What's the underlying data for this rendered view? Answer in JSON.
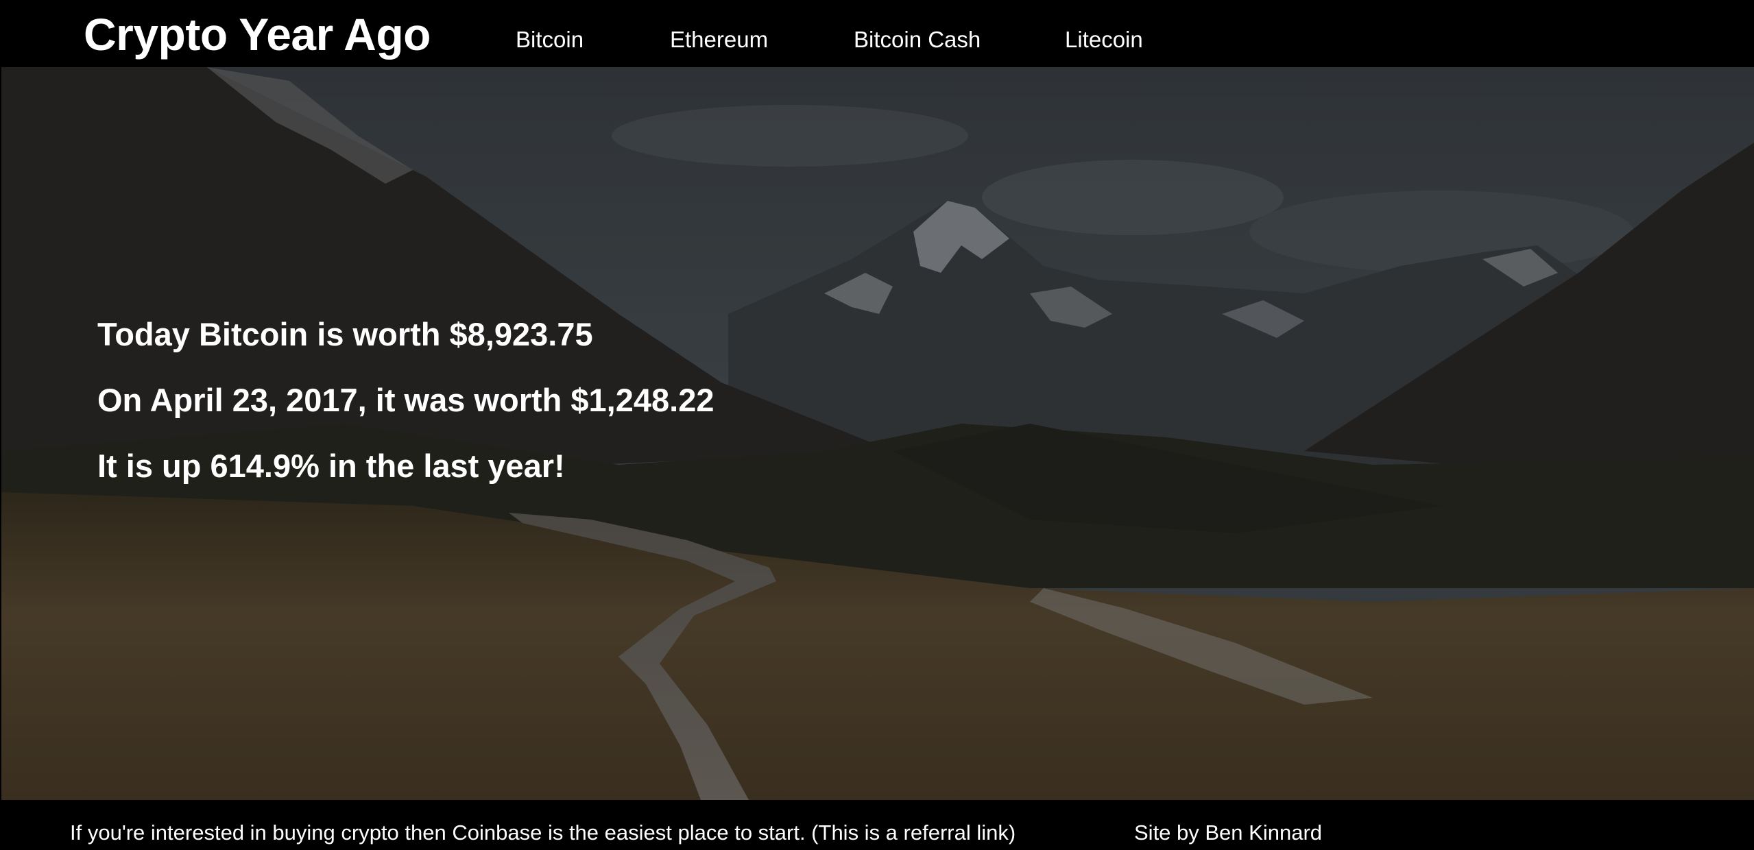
{
  "header": {
    "title": "Crypto Year Ago",
    "nav": {
      "bitcoin": "Bitcoin",
      "ethereum": "Ethereum",
      "bitcoin_cash": "Bitcoin Cash",
      "litecoin": "Litecoin"
    }
  },
  "hero": {
    "today_line": "Today Bitcoin is worth $8,923.75",
    "past_line": "On April 23, 2017, it was worth $1,248.22",
    "change_line": "It is up 614.9% in the last year!",
    "background": "mountain-valley-boardwalk-photo"
  },
  "footer": {
    "referral_text": "If you're interested in buying crypto then Coinbase is the easiest place to start. (This is a referral link)",
    "credit_text": "Site by Ben Kinnard"
  },
  "colors": {
    "background": "#000000",
    "text": "#ffffff"
  }
}
